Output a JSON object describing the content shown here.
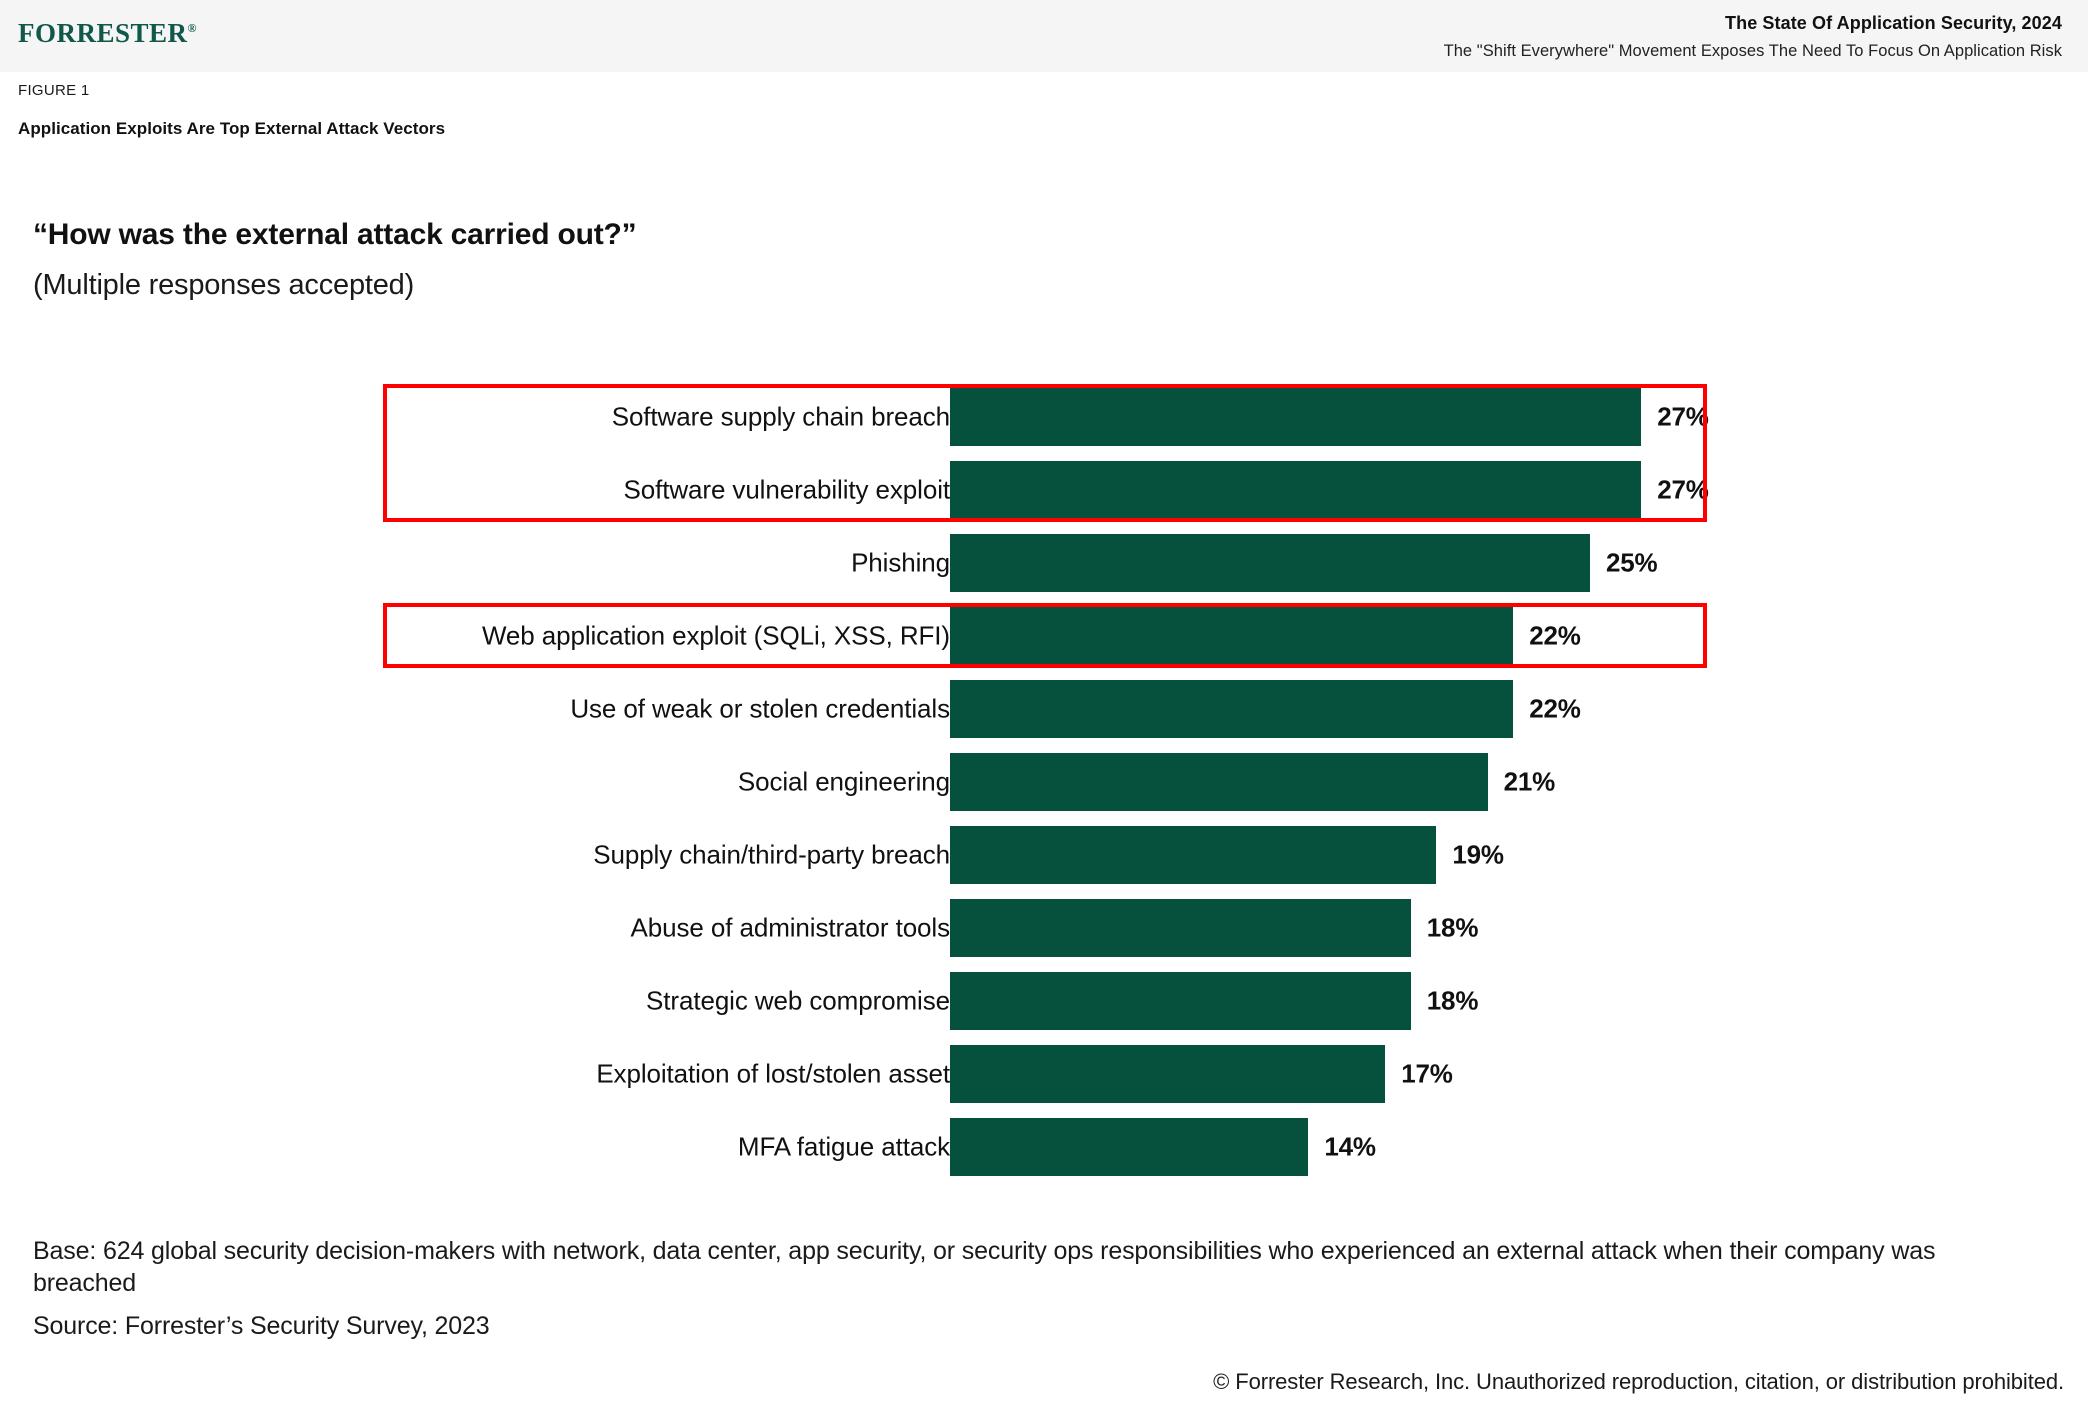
{
  "header": {
    "brand": "FORRESTER",
    "brand_mark": "®",
    "report_title": "The State Of Application Security, 2024",
    "report_subtitle": "The \"Shift Everywhere\" Movement Exposes The Need To Focus On Application Risk"
  },
  "figure": {
    "label": "FIGURE 1",
    "title": "Application Exploits Are Top External Attack Vectors"
  },
  "chart_data": {
    "type": "bar",
    "orientation": "horizontal",
    "title": "“How was the external attack carried out?”",
    "subtitle": "(Multiple responses accepted)",
    "xlabel": "",
    "ylabel": "",
    "xlim": [
      0,
      27
    ],
    "grid": false,
    "legend": null,
    "value_suffix": "%",
    "bar_color": "#06503e",
    "highlight_color": "#ff0000",
    "categories": [
      "Software supply chain breach",
      "Software vulnerability exploit",
      "Phishing",
      "Web application exploit (SQLi, XSS, RFI)",
      "Use of weak or stolen credentials",
      "Social engineering",
      "Supply chain/third-party breach",
      "Abuse of administrator tools",
      "Strategic web compromise",
      "Exploitation of lost/stolen asset",
      "MFA fatigue attack"
    ],
    "values": [
      27,
      27,
      25,
      22,
      22,
      21,
      19,
      18,
      18,
      17,
      14
    ],
    "value_labels": [
      "27%",
      "27%",
      "25%",
      "22%",
      "22%",
      "21%",
      "19%",
      "18%",
      "18%",
      "17%",
      "14%"
    ],
    "highlighted_categories": [
      "Software supply chain breach",
      "Software vulnerability exploit",
      "Web application exploit (SQLi, XSS, RFI)"
    ]
  },
  "footer": {
    "base": "Base: 624 global security decision-makers with network, data center, app security, or security ops responsibilities who experienced an external attack when their company was breached",
    "source": "Source: Forrester’s Security Survey, 2023",
    "copyright": "© Forrester Research, Inc. Unauthorized reproduction, citation, or distribution prohibited."
  }
}
